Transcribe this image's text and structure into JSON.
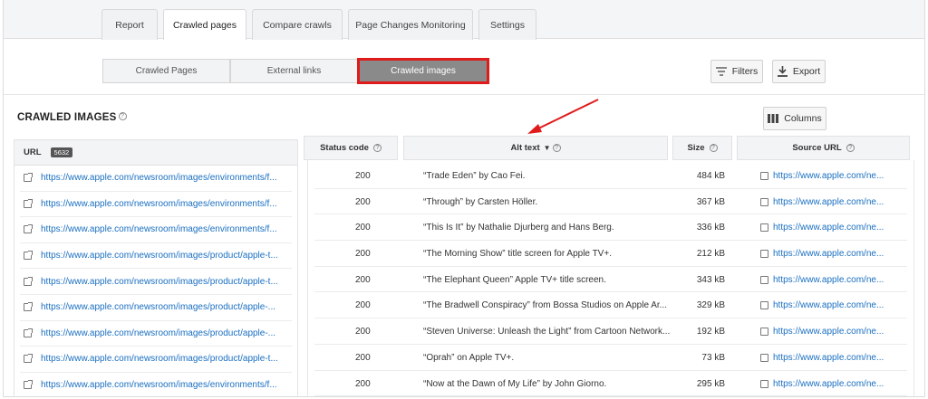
{
  "tabs": [
    {
      "label": "Report",
      "active": false
    },
    {
      "label": "Crawled pages",
      "active": true
    },
    {
      "label": "Compare crawls",
      "active": false
    },
    {
      "label": "Page Changes Monitoring",
      "active": false
    },
    {
      "label": "Settings",
      "active": false
    }
  ],
  "segments": [
    {
      "label": "Crawled Pages",
      "active": false
    },
    {
      "label": "External links",
      "active": false
    },
    {
      "label": "Crawled images",
      "active": true
    }
  ],
  "toolbar": {
    "filters_label": "Filters",
    "export_label": "Export",
    "columns_label": "Columns"
  },
  "section_title": "CRAWLED IMAGES",
  "left_panel": {
    "header": "URL",
    "count": "5632"
  },
  "columns": {
    "status": "Status code",
    "alt": "Alt text",
    "size": "Size",
    "source": "Source URL"
  },
  "left_urls": [
    "https://www.apple.com/newsroom/images/environments/f...",
    "https://www.apple.com/newsroom/images/environments/f...",
    "https://www.apple.com/newsroom/images/environments/f...",
    "https://www.apple.com/newsroom/images/product/apple-t...",
    "https://www.apple.com/newsroom/images/product/apple-t...",
    "https://www.apple.com/newsroom/images/product/apple-...",
    "https://www.apple.com/newsroom/images/product/apple-...",
    "https://www.apple.com/newsroom/images/product/apple-t...",
    "https://www.apple.com/newsroom/images/environments/f..."
  ],
  "rows": [
    {
      "status": "200",
      "alt": "“Trade Eden” by Cao Fei.",
      "size": "484 kB",
      "source": "https://www.apple.com/ne..."
    },
    {
      "status": "200",
      "alt": "“Through” by Carsten Höller.",
      "size": "367 kB",
      "source": "https://www.apple.com/ne..."
    },
    {
      "status": "200",
      "alt": "“This Is It” by Nathalie Djurberg and Hans Berg.",
      "size": "336 kB",
      "source": "https://www.apple.com/ne..."
    },
    {
      "status": "200",
      "alt": "“The Morning Show” title screen for Apple TV+.",
      "size": "212 kB",
      "source": "https://www.apple.com/ne..."
    },
    {
      "status": "200",
      "alt": "“The Elephant Queen” Apple TV+ title screen.",
      "size": "343 kB",
      "source": "https://www.apple.com/ne..."
    },
    {
      "status": "200",
      "alt": "“The Bradwell Conspiracy” from Bossa Studios on Apple Ar...",
      "size": "329 kB",
      "source": "https://www.apple.com/ne..."
    },
    {
      "status": "200",
      "alt": "“Steven Universe: Unleash the Light” from Cartoon Network...",
      "size": "192 kB",
      "source": "https://www.apple.com/ne..."
    },
    {
      "status": "200",
      "alt": "“Oprah” on Apple TV+.",
      "size": "73 kB",
      "source": "https://www.apple.com/ne..."
    },
    {
      "status": "200",
      "alt": "“Now at the Dawn of My Life” by John Giorno.",
      "size": "295 kB",
      "source": "https://www.apple.com/ne..."
    }
  ],
  "colors": {
    "link": "#1a6fc1",
    "highlight": "#e01b1b",
    "active_segment": "#8a8a8a"
  }
}
